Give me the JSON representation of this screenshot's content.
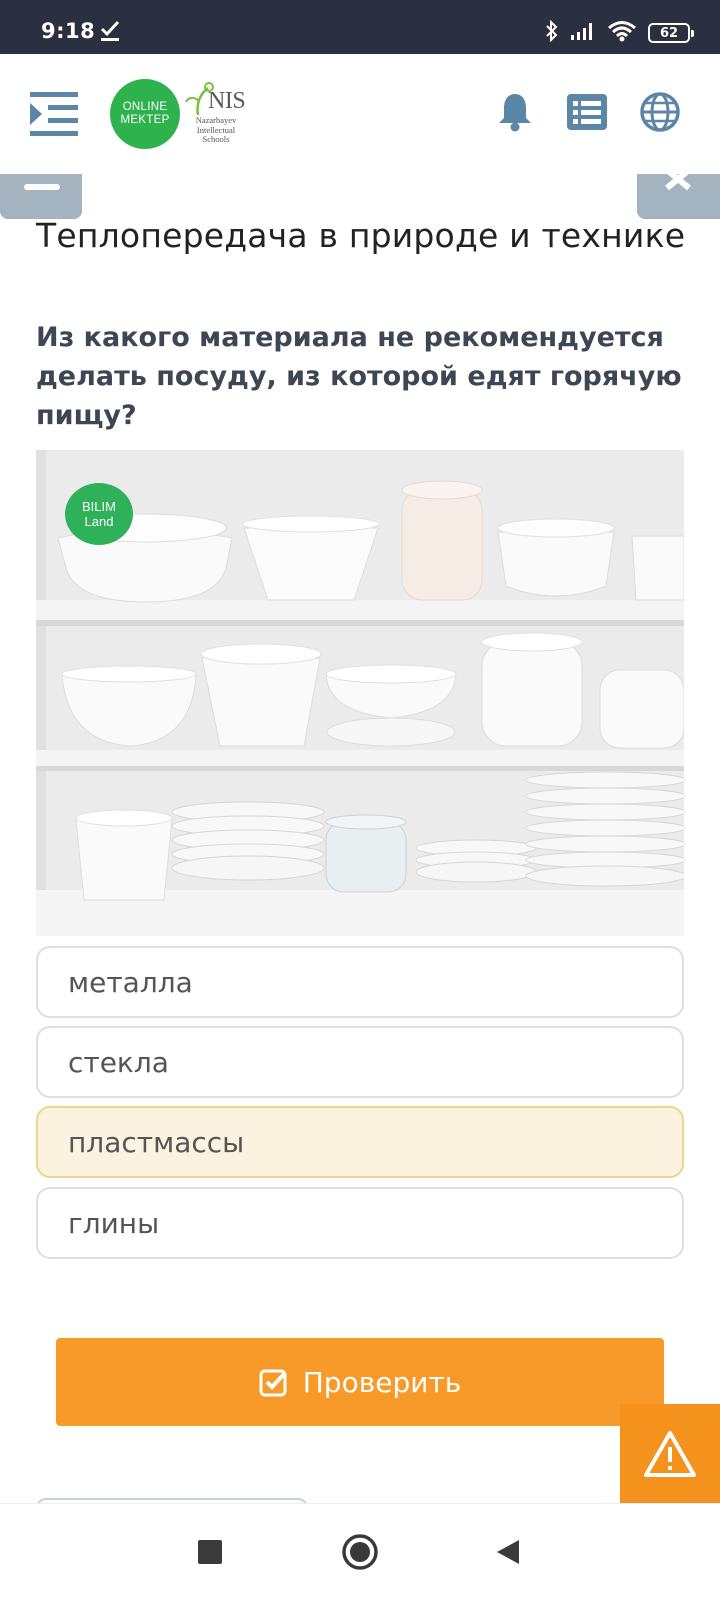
{
  "status_bar": {
    "time": "9:18",
    "battery": "62"
  },
  "header": {
    "logo_online_line1": "ONLINE",
    "logo_online_line2": "MEKTEP",
    "logo_nis_title": "NIS",
    "logo_nis_sub1": "Nazarbayev",
    "logo_nis_sub2": "Intellectual",
    "logo_nis_sub3": "Schools"
  },
  "lesson": {
    "title": "Теплопередача в природе и технике",
    "question": "Из какого материала не рекомендуется делать посуду, из которой едят горячую пищу?",
    "image_badge_line1": "BILIM",
    "image_badge_line2": "Land"
  },
  "options": [
    {
      "label": "металла",
      "selected": false
    },
    {
      "label": "стекла",
      "selected": false
    },
    {
      "label": "пластмассы",
      "selected": true
    },
    {
      "label": "глины",
      "selected": false
    }
  ],
  "check_button": {
    "label": "Проверить"
  },
  "colors": {
    "status_bar_bg": "#2b3040",
    "accent_orange": "#f79a2a",
    "brand_green": "#2eb24e",
    "selected_option_bg": "#fbf3df",
    "tab_blue_gray": "#a3b3bf"
  },
  "icons": {
    "menu": "menu-indent-icon",
    "notifications": "bell-icon",
    "list": "list-icon",
    "language": "globe-icon",
    "report": "warning-icon",
    "check": "checkbox-check-icon"
  }
}
